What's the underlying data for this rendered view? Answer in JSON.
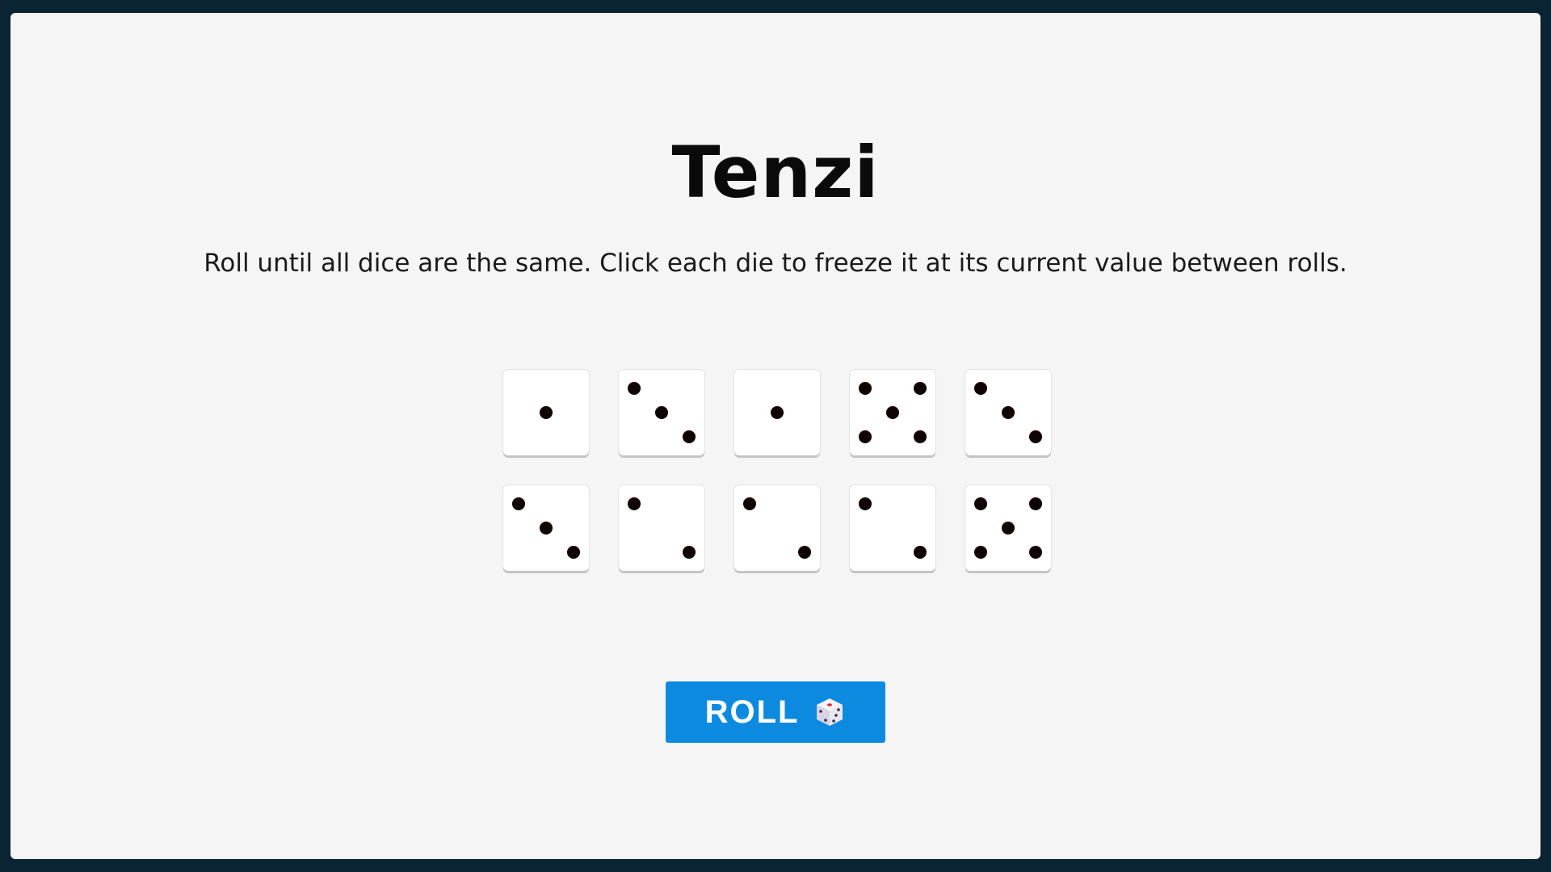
{
  "game": {
    "title": "Tenzi",
    "instructions": "Roll until all dice are the same. Click each die to freeze it at its current value between rolls."
  },
  "dice": [
    {
      "value": 1,
      "held": false
    },
    {
      "value": 3,
      "held": false
    },
    {
      "value": 1,
      "held": false
    },
    {
      "value": 5,
      "held": false
    },
    {
      "value": 3,
      "held": false
    },
    {
      "value": 3,
      "held": false
    },
    {
      "value": 2,
      "held": false
    },
    {
      "value": 2,
      "held": false
    },
    {
      "value": 2,
      "held": false
    },
    {
      "value": 5,
      "held": false
    }
  ],
  "roll_button": {
    "label": "ROLL",
    "icon": "game-die-icon"
  },
  "colors": {
    "frame": "#0b2434",
    "board": "#f5f5f5",
    "button": "#0b8ae0",
    "pip": "#0e0305"
  }
}
